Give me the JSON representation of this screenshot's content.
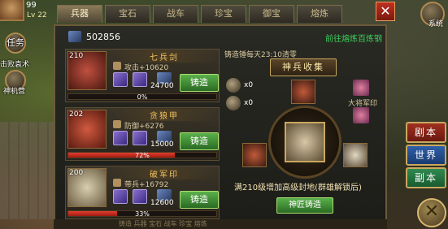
{
  "hud": {
    "top_number": "99",
    "level": "Lv 22",
    "quest_label": "任务",
    "quest_sub": "击败袁术",
    "divine_label": "神机营",
    "system_label": "系统"
  },
  "tabs": [
    "兵器",
    "宝石",
    "战车",
    "珍宝",
    "御宝",
    "熔炼"
  ],
  "resource": {
    "value": "502856",
    "link": "前往熔炼百炼钢"
  },
  "items": [
    {
      "level": "210",
      "name": "七兵剑",
      "stat": "攻击+10620",
      "cost": "24700",
      "button": "铸造",
      "progress_text": "0%",
      "progress": 0
    },
    {
      "level": "202",
      "name": "贪狼甲",
      "stat": "防御+6276",
      "cost": "15000",
      "button": "铸造",
      "progress_text": "72%",
      "progress": 0.72
    },
    {
      "level": "200",
      "name": "破军印",
      "stat": "带兵+16792",
      "cost": "12600",
      "button": "铸造",
      "progress_text": "33%",
      "progress": 0.33
    }
  ],
  "collection": {
    "info": "铸造锤每天23:10清零",
    "banner": "神兵收集",
    "hammer1": "x0",
    "hammer2": "x0",
    "general": "大将军印",
    "unlock": "满210级增加高级封地(群雄解锁后)",
    "master_button": "神匠铸造"
  },
  "right_buttons": [
    "剧本",
    "世界",
    "副本"
  ],
  "bottom_strip": "铸造  兵器  宝石  战车  珍宝  熔炼"
}
